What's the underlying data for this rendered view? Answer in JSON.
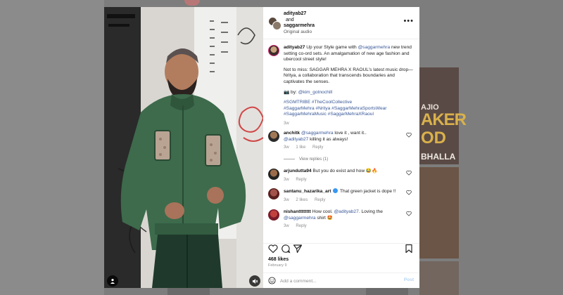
{
  "header": {
    "user1": "adityab27",
    "and": "and",
    "user2": "saggarmehra",
    "audio": "Original audio",
    "more_label": "•••"
  },
  "caption": {
    "user": "adityab27",
    "p1_pre": "Up your Style game with",
    "p1_mention": "@saggarmehra",
    "p1_post": "new trend setting co-ord sets. An amalgamation of new age fashion and ubercool street style!",
    "p2": "Not to miss: SAGGAR MEHRA X RAOUL's latest music drop—Nritya, a collaboration that transcends boundaries and captivates the senses.",
    "p3_prefix": "📷 by:",
    "p3_mention": "@kim_gotnochill",
    "hashtags_line1": "#SGMTRIBE #TheCoolCollective",
    "hashtags_line2": "#SaggarMehra #Nritya #SaggarMehraSportsWear",
    "hashtags_line3": "#SaggarMehraMusic #SaggarMehraXRaoul",
    "time": "3w"
  },
  "comments": [
    {
      "user": "anchitk",
      "mention": "@saggarmehra",
      "text": "love it , want it..",
      "line2_mention": "@adityab27",
      "line2_text": "killing it as always!",
      "time": "3w",
      "likes": "1 like",
      "reply": "Reply",
      "view_replies": "View replies (1)"
    },
    {
      "user": "arjundutta94",
      "text": "But you do exist and how 😂🔥",
      "time": "3w",
      "reply": "Reply"
    },
    {
      "user": "santanu_hazarika_art",
      "text": "That green jacket is dope !!",
      "time": "3w",
      "likes": "2 likes",
      "reply": "Reply"
    },
    {
      "user": "nishantttttttt",
      "text_pre": "How cool.",
      "mention": "@adityab27.",
      "text_post": "Loving the",
      "line2_mention": "@saggarmehra",
      "line2_text": "shirt 🤩",
      "time": "3w",
      "reply": "Reply"
    }
  ],
  "footer": {
    "likes": "468 likes",
    "date": "February 9",
    "comment_placeholder": "Add a comment...",
    "post_label": "Post"
  },
  "background": {
    "ajio": "AJIO",
    "aker": "AKER",
    "od": "OD",
    "bhalla": "BHALLA"
  },
  "colors": {
    "accent_link": "#385898",
    "verified": "#3897f0",
    "heart_active": "#ed4956",
    "jacket_green": "#3d6b4c"
  },
  "icons": {
    "like": "heart-icon",
    "comment": "comment-icon",
    "share": "share-icon",
    "save": "bookmark-icon",
    "emoji": "emoji-icon",
    "user_tag": "user-tag-icon",
    "audio": "audio-muted-icon",
    "more": "more-options-icon"
  }
}
